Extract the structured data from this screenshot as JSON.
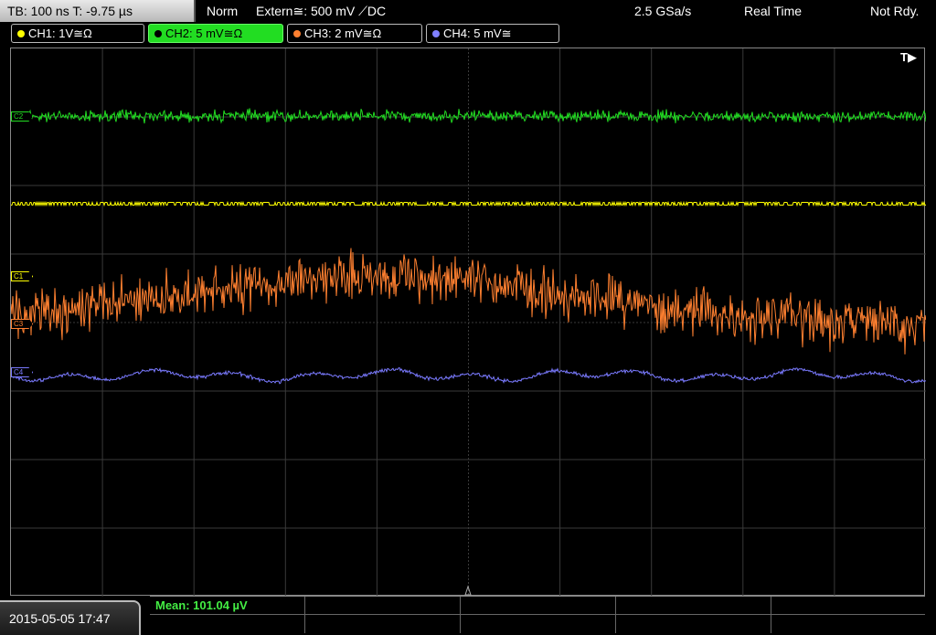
{
  "topbar": {
    "timebase": "TB: 100 ns   T: -9.75 µs",
    "mode": "Norm",
    "trigger": "Extern≅: 500 mV ⟋DC",
    "sample_rate": "2.5 GSa/s",
    "acq_mode": "Real Time",
    "status": "Not Rdy."
  },
  "channels": [
    {
      "label": "CH1: 1V≅Ω",
      "color": "#ffff00",
      "active": false
    },
    {
      "label": "CH2: 5 mV≅Ω",
      "color": "#22dd22",
      "active": true
    },
    {
      "label": "CH3: 2 mV≅Ω",
      "color": "#ff8030",
      "active": false
    },
    {
      "label": "CH4: 5 mV≅",
      "color": "#8080ff",
      "active": false
    }
  ],
  "markers": {
    "c1": "C1",
    "c2": "C2",
    "c3": "C3",
    "c4": "C4",
    "trigger_position": "T▶"
  },
  "colors": {
    "ch1": "#ffff00",
    "ch2": "#22dd22",
    "ch3": "#ff8030",
    "ch4": "#7a7aff",
    "grid": "#3a3a3a"
  },
  "footer": {
    "datetime": "2015-05-05 17:47",
    "measurement": "Mean: 101.04 µV"
  }
}
